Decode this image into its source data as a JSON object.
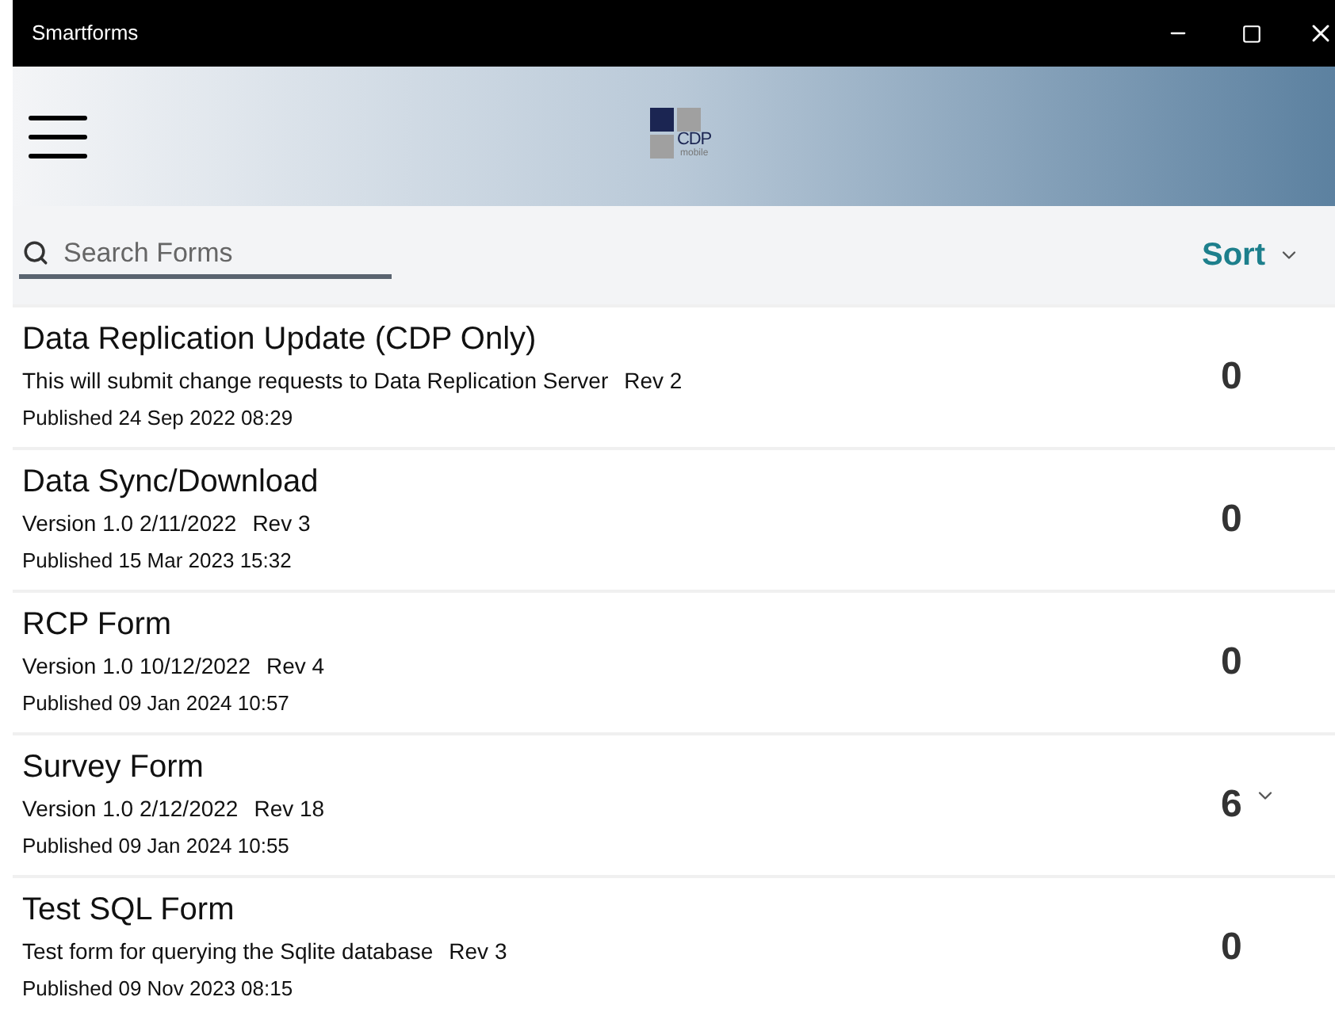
{
  "window": {
    "title": "Smartforms"
  },
  "header": {
    "logo": {
      "text": "CDP",
      "subtext": "mobile"
    }
  },
  "search": {
    "placeholder": "Search Forms"
  },
  "sort": {
    "label": "Sort"
  },
  "forms": [
    {
      "title": "Data Replication Update (CDP Only)",
      "description": "This will submit change requests to Data Replication Server",
      "rev": "Rev 2",
      "published": "Published 24 Sep 2022 08:29",
      "count": "0",
      "expandable": false
    },
    {
      "title": "Data Sync/Download",
      "description": "Version 1.0 2/11/2022",
      "rev": "Rev 3",
      "published": "Published 15 Mar 2023 15:32",
      "count": "0",
      "expandable": false
    },
    {
      "title": "RCP Form",
      "description": "Version 1.0 10/12/2022",
      "rev": "Rev 4",
      "published": "Published 09 Jan 2024 10:57",
      "count": "0",
      "expandable": false
    },
    {
      "title": "Survey Form",
      "description": "Version 1.0 2/12/2022",
      "rev": "Rev 18",
      "published": "Published 09 Jan 2024 10:55",
      "count": "6",
      "expandable": true
    },
    {
      "title": "Test SQL Form",
      "description": "Test form for querying the Sqlite database",
      "rev": "Rev 3",
      "published": "Published 09 Nov 2023 08:15",
      "count": "0",
      "expandable": false
    }
  ]
}
